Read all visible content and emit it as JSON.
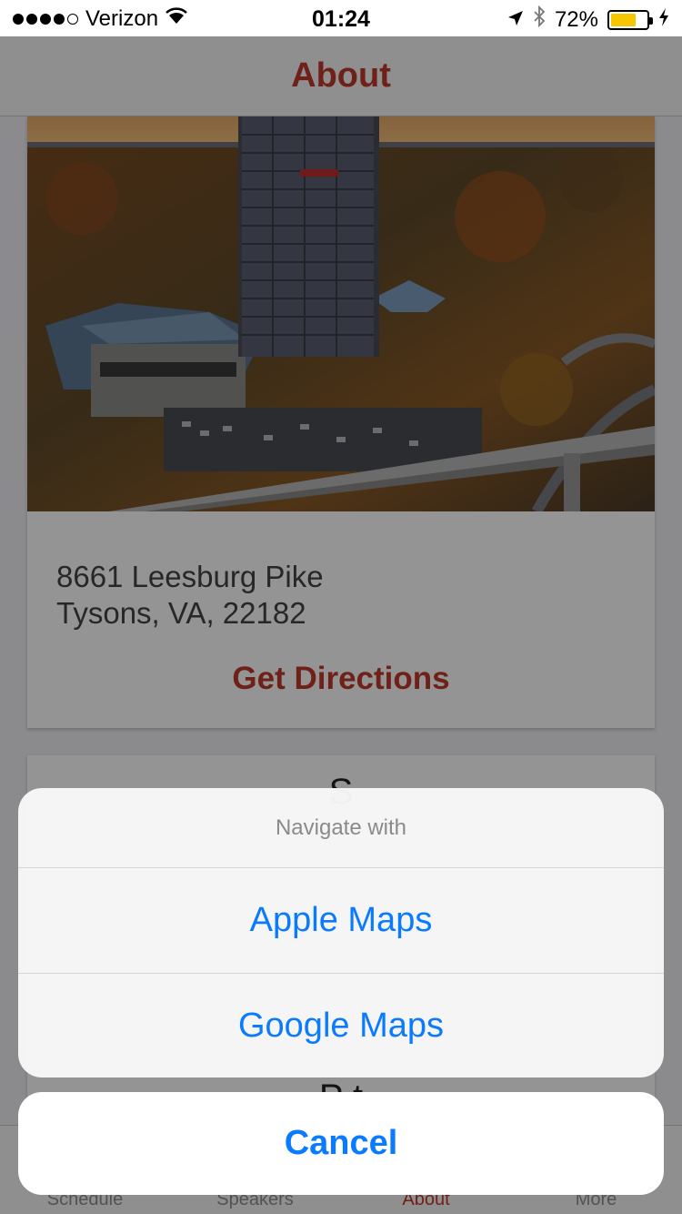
{
  "status_bar": {
    "carrier": "Verizon",
    "time": "01:24",
    "battery_percent": "72%",
    "battery_level": 0.72,
    "battery_color": "#f7c600",
    "icons": [
      "signal-dots-icon",
      "wifi-icon",
      "location-arrow-icon",
      "bluetooth-icon",
      "battery-icon",
      "charging-bolt-icon"
    ]
  },
  "nav": {
    "title": "About",
    "accent_color": "#c0392b"
  },
  "venue": {
    "photo": "hotel-tower-aerial-photo",
    "address_line1": "8661 Leesburg Pike",
    "address_line2": "Tysons, VA, 22182",
    "directions_label": "Get Directions"
  },
  "second_card": {
    "peek_top": "S",
    "peek_bottom": "P t"
  },
  "tabs": [
    {
      "label": "Schedule"
    },
    {
      "label": "Speakers"
    },
    {
      "label": "About"
    },
    {
      "label": "More"
    }
  ],
  "action_sheet": {
    "title": "Navigate with",
    "options": [
      "Apple Maps",
      "Google Maps"
    ],
    "cancel_label": "Cancel",
    "button_color": "#0a7aff"
  }
}
